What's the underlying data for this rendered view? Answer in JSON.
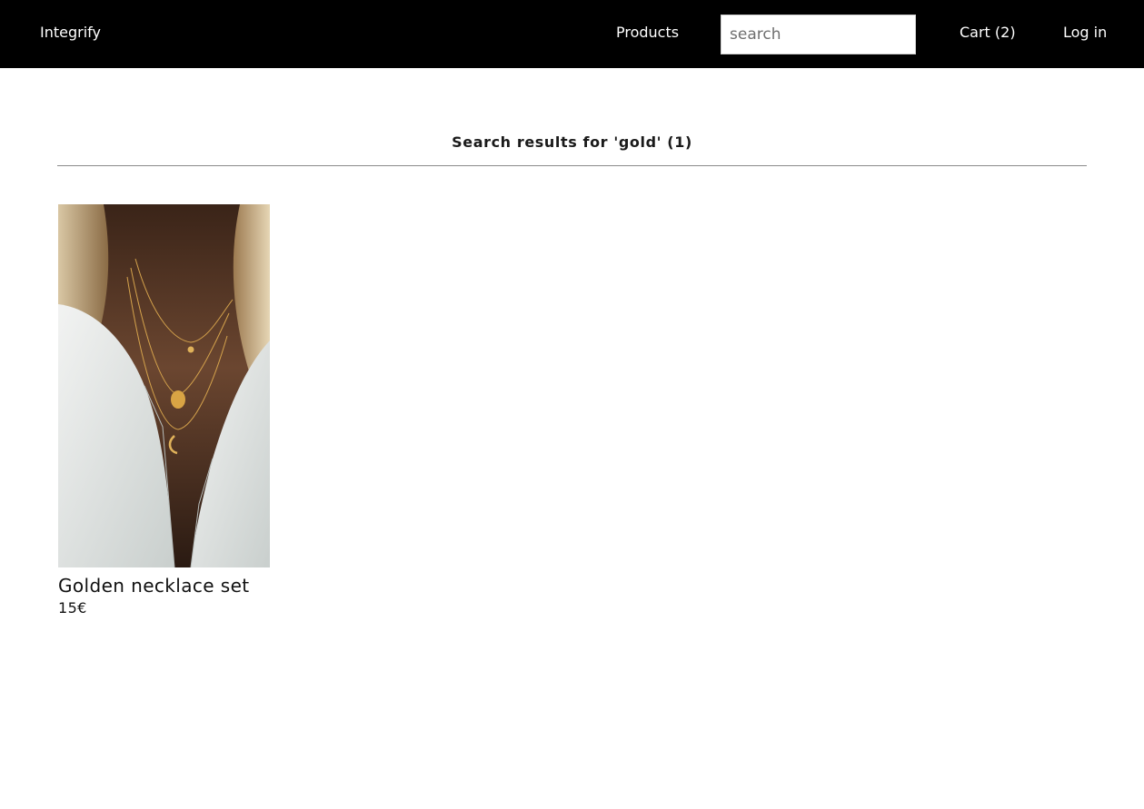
{
  "header": {
    "brand": "Integrify",
    "nav": {
      "products_label": "Products",
      "cart_label": "Cart (2)",
      "login_label": "Log in"
    },
    "search": {
      "placeholder": "search",
      "value": ""
    }
  },
  "main": {
    "results_heading": "Search results for 'gold' (1)",
    "products": [
      {
        "name": "Golden necklace set",
        "price": "15€"
      }
    ]
  },
  "colors": {
    "navbar_background": "#000000",
    "navbar_text": "#ffffff",
    "divider": "#8a8a8a"
  }
}
